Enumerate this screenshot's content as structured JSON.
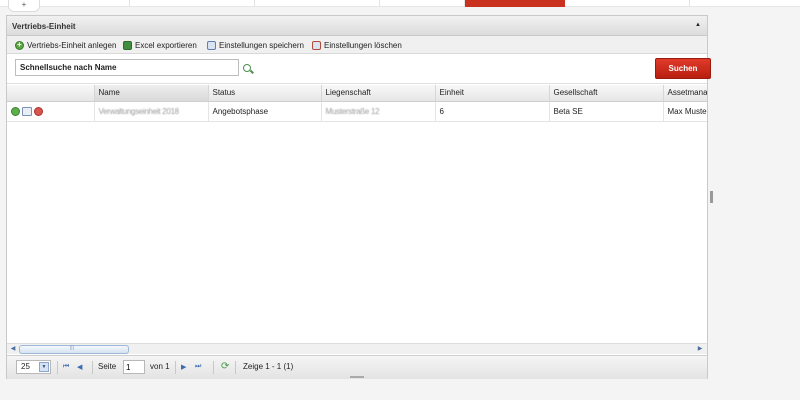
{
  "tab": {
    "plus": "+"
  },
  "panel": {
    "title": "Vertriebs-Einheit",
    "collapse_icon": "caret-up-icon"
  },
  "toolbar": {
    "create": "Vertriebs-Einheit anlegen",
    "export": "Excel exportieren",
    "save_settings": "Einstellungen speichern",
    "delete_settings": "Einstellungen löschen"
  },
  "search": {
    "placeholder": "Schnellsuche nach Name",
    "button": "Suchen"
  },
  "colors": {
    "accent": "#c8321e",
    "button": "#d32f1f"
  },
  "grid": {
    "columns": [
      "Name",
      "Status",
      "Liegenschaft",
      "Einheit",
      "Gesellschaft",
      "Assetmanag"
    ],
    "rows": [
      {
        "icons": [
          "check-circle-icon",
          "edit-icon",
          "stop-circle-icon"
        ],
        "name": "Verwaltungseinheit 2018",
        "status": "Angebotsphase",
        "liegenschaft": "Musterstraße 12",
        "einheit": "6",
        "gesellschaft": "Beta SE",
        "asset": "Max Musterm"
      }
    ]
  },
  "pager": {
    "page_size": "25",
    "page_label": "Seite",
    "page_value": "1",
    "of_label": "von 1",
    "summary": "Zeige 1 - 1 (1)",
    "first": "⏮",
    "prev": "◀",
    "next": "▶",
    "last": "⏭",
    "dropdown": "▼",
    "refresh": "⟳",
    "hscroll_left": "◀",
    "hscroll_right": "▶"
  }
}
